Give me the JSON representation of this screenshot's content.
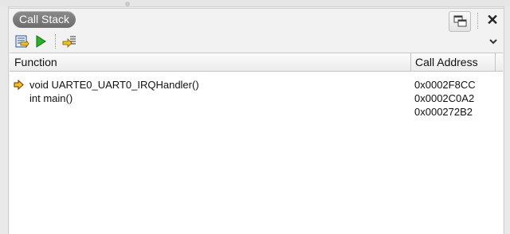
{
  "panel": {
    "title": "Call Stack"
  },
  "title_bar": {
    "float_icon": "float-window-icon",
    "close_glyph": "✕"
  },
  "toolbar": {
    "buttons": [
      {
        "icon": "show-source-icon"
      },
      {
        "icon": "run-to-icon"
      },
      {
        "icon": "step-out-icon"
      }
    ],
    "menu_icon": "chevron-down-icon"
  },
  "columns": {
    "function": "Function",
    "call_address": "Call Address"
  },
  "frames": [
    {
      "function": "void UARTE0_UART0_IRQHandler()",
      "address": "0x0002F8CC",
      "current": true
    },
    {
      "function": "int main()",
      "address": "0x0002C0A2",
      "current": false
    },
    {
      "function": "",
      "address": "0x000272B2",
      "current": false
    }
  ],
  "colors": {
    "current_marker": "#f2c40f",
    "run_icon": "#22b422",
    "title_pill": "#7a7a7a"
  }
}
